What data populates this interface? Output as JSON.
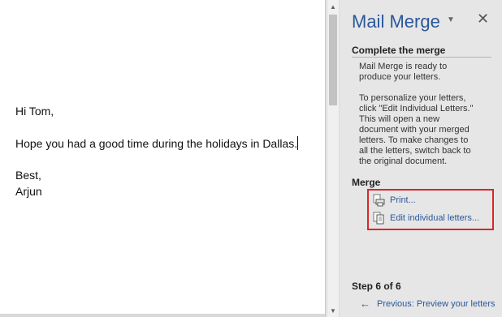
{
  "document": {
    "greeting": "Hi Tom,",
    "body": "Hope you had a good time during the holidays in Dallas.",
    "closing": "Best,",
    "signature": "Arjun"
  },
  "pane": {
    "title": "Mail Merge",
    "complete_heading": "Complete the merge",
    "ready_lines": [
      "Mail Merge is ready to",
      "produce your letters."
    ],
    "personalize_lines": [
      "To personalize your letters,",
      "click \"Edit Individual Letters.\"",
      "This will open a new",
      "document with your merged",
      "letters. To make changes to",
      "all the letters, switch back to",
      "the original document."
    ],
    "merge_heading": "Merge",
    "print_label": "Print...",
    "edit_label": "Edit individual letters...",
    "step_label": "Step 6 of 6",
    "previous_label": "Previous: Preview your letters"
  },
  "colors": {
    "accent": "#2b579a",
    "highlight": "#d9262a"
  },
  "icons": {
    "pane_menu": "dropdown-triangle-icon",
    "pane_close": "close-icon",
    "print": "print-icon",
    "edit": "document-edit-icon",
    "previous": "arrow-left-icon"
  }
}
